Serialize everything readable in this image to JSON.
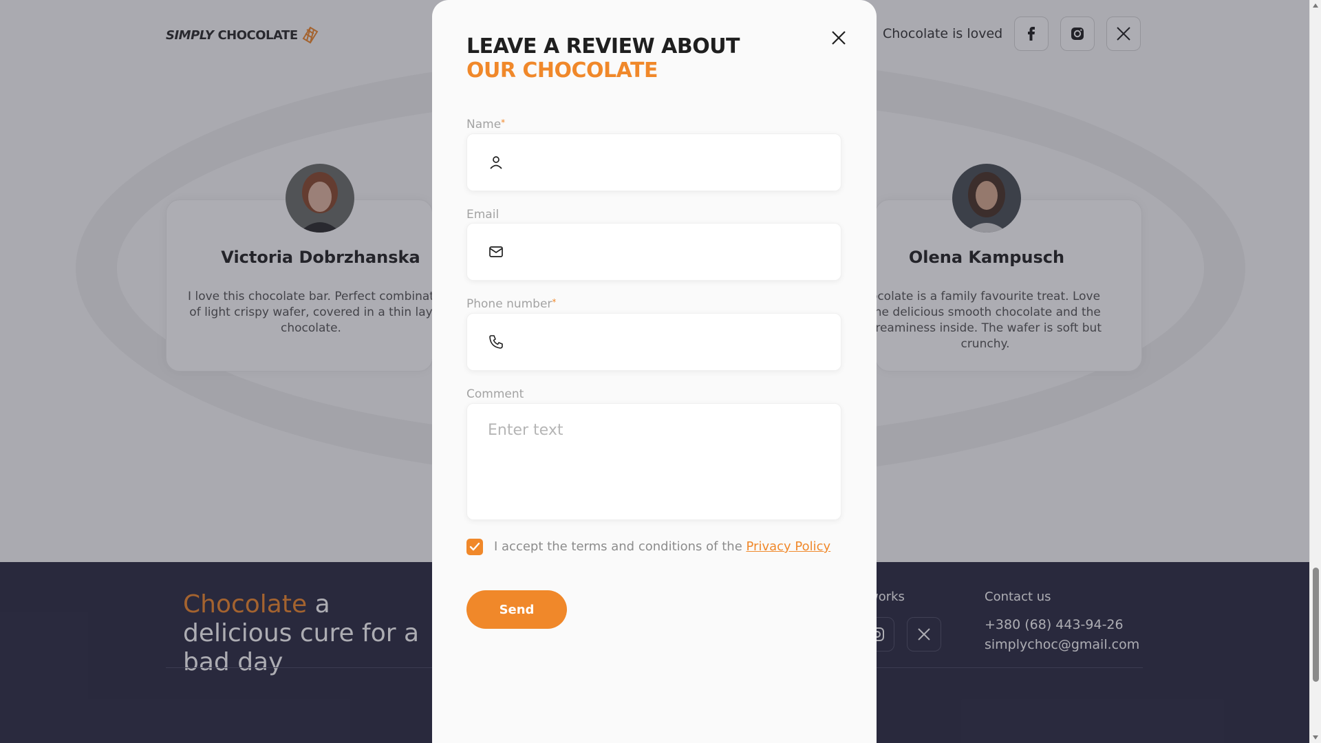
{
  "header": {
    "logo_part1": "SIMPLY",
    "logo_part2": "CHOCOLATE",
    "tagline": "Chocolate is loved",
    "social": [
      "facebook-icon",
      "instagram-icon",
      "x-icon"
    ]
  },
  "reviews": [
    {
      "name": "Victoria Dobrzhanska",
      "text": "I love this chocolate bar. Perfect combinat of light crispy wafer, covered in a thin lay chocolate."
    },
    {
      "name": "Olena Kampusch",
      "text": "ocolate is a family favourite treat. Love the delicious smooth chocolate and the creaminess inside. The wafer is soft but crunchy."
    }
  ],
  "footer": {
    "slogan_accent": "Chocolate",
    "slogan_rest": " a delicious cure for a bad day",
    "networks_heading": "works",
    "contact_heading": "Contact us",
    "phone": "+380 (68) 443-94-26",
    "email": "simplychoc@gmail.com"
  },
  "modal": {
    "title_line1": "LEAVE A REVIEW ABOUT",
    "title_line2": "OUR CHOCOLATE",
    "name_label": "Name",
    "email_label": "Email",
    "phone_label": "Phone number",
    "comment_label": "Comment",
    "required_mark": "*",
    "name_value": "",
    "email_value": "",
    "phone_value": "",
    "comment_placeholder": "Enter text",
    "terms_text": "I accept the terms and conditions of the ",
    "terms_link": "Privacy Policy",
    "terms_checked": true,
    "send_label": "Send"
  },
  "colors": {
    "accent": "#f0882a",
    "footer_bg": "#2b2b42",
    "modal_bg": "#fafafa"
  }
}
